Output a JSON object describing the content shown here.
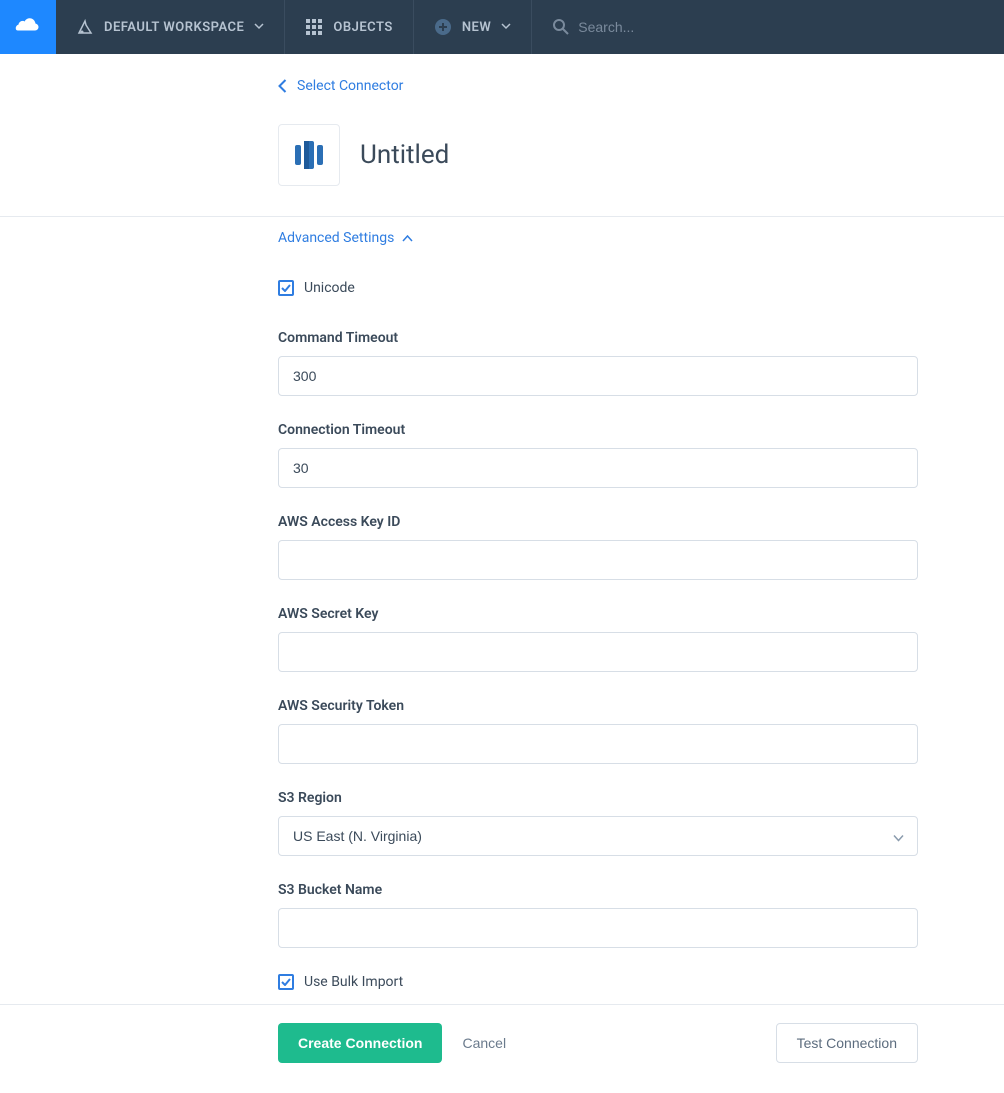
{
  "nav": {
    "workspace_label": "DEFAULT WORKSPACE",
    "objects_label": "OBJECTS",
    "new_label": "NEW",
    "search_placeholder": "Search..."
  },
  "header": {
    "back_label": "Select Connector",
    "title": "Untitled"
  },
  "form": {
    "advanced_toggle": "Advanced Settings",
    "unicode_label": "Unicode",
    "unicode_checked": true,
    "command_timeout_label": "Command Timeout",
    "command_timeout_value": "300",
    "connection_timeout_label": "Connection Timeout",
    "connection_timeout_value": "30",
    "aws_access_key_label": "AWS Access Key ID",
    "aws_access_key_value": "",
    "aws_secret_key_label": "AWS Secret Key",
    "aws_secret_key_value": "",
    "aws_security_token_label": "AWS Security Token",
    "aws_security_token_value": "",
    "s3_region_label": "S3 Region",
    "s3_region_value": "US East (N. Virginia)",
    "s3_bucket_label": "S3 Bucket Name",
    "s3_bucket_value": "",
    "use_bulk_import_label": "Use Bulk Import",
    "use_bulk_import_checked": true
  },
  "footer": {
    "create_label": "Create Connection",
    "cancel_label": "Cancel",
    "test_label": "Test Connection"
  },
  "colors": {
    "accent_blue": "#2f7de1",
    "nav_bg": "#2c3e50",
    "logo_bg": "#1e88ff",
    "primary_btn": "#1ebb8e"
  }
}
